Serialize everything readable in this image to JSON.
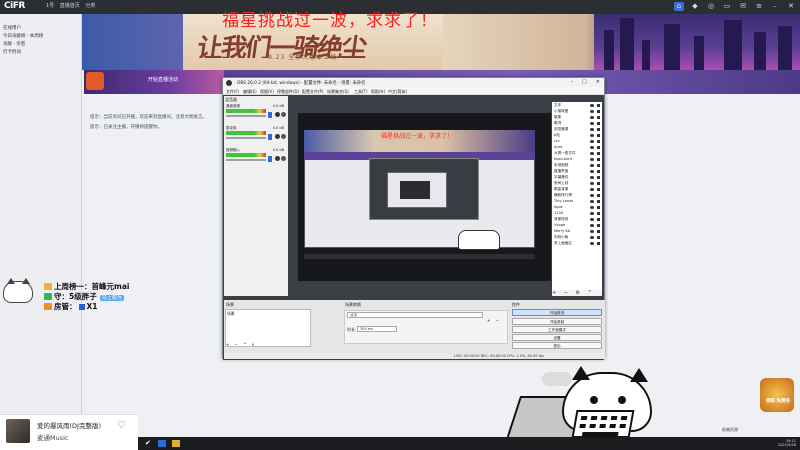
{
  "topbar": {
    "logo": "CiFR",
    "meta": [
      "1号",
      "直播首页",
      "分类"
    ],
    "icons": [
      "home-icon",
      "game-icon",
      "gamepad-icon",
      "tv-icon",
      "chat-icon",
      "menu-icon",
      "minimize-icon",
      "close-icon"
    ]
  },
  "leftpanel": {
    "rows": [
      "在线用户",
      "今日贡献榜 · 本周榜",
      "贡献 · 亲密",
      "打卡时间"
    ]
  },
  "banner": {
    "overlay_text": "福星挑战过一波，求求了！",
    "art_text": "让我们一骑绝尘",
    "subtitle": "9.23 全新大版本上线"
  },
  "promo": {
    "label": "开始直播活动"
  },
  "chat": {
    "lines": [
      "提示：当前房间已开播，欢迎来到直播间，注意文明发言。",
      "提示：已关注主播，开播将提醒你。"
    ]
  },
  "obs": {
    "title": "OBS 26.0.2 (64-bit, windows) - 配置文件: 未命名 - 场景: 未命名",
    "menu": [
      "文件(F)",
      "编辑(E)",
      "视图(V)",
      "停靠部件(D)",
      "配置文件(P)",
      "场景集合(S)",
      "工具(T)",
      "帮助(H)",
      "中文(简体)"
    ],
    "mixer_title": "混音器",
    "tracks": [
      {
        "label": "桌面音频",
        "db": "0.0 dB"
      },
      {
        "label": "麦克风",
        "db": "0.0 dB"
      },
      {
        "label": "音频输入",
        "db": "0.0 dB"
      }
    ],
    "preview_overlay": "福星挑战过一波，求求了！",
    "sources": [
      "文本",
      "小猫咪图",
      "摄像",
      "歌词",
      "浏览器源",
      "b站",
      "ccc",
      "Aunt",
      "大屏一般文件",
      "kkod-bunt",
      "本地视频",
      "直播界面",
      "字幕爆闪",
      "房间上线",
      "歌曲背景",
      "爆款排行榜",
      "Tiny Lands",
      "Ayoe",
      "1204",
      "背景特效",
      "Vcoge",
      "Merry Kb",
      "闪烁小鱼",
      "其上画面区"
    ],
    "source_toolbar": "+ − ⚙ ^ v",
    "scenes_head": "场景",
    "scenes": [
      "场景"
    ],
    "scene_toolbar": "+ − ^ v",
    "transition_head": "场景转换",
    "transition_value": "淡出",
    "duration_label": "时长",
    "duration_value": "300 ms",
    "controls_head": "控件",
    "controls": [
      "开始推流",
      "开始录制",
      "工作室模式",
      "设置",
      "退出"
    ],
    "status": "LIVE: 00:00:00    REC: 00:00:00    CPU: 1.9%, 60.00 fps"
  },
  "viewers": {
    "line1_label": "上周榜一：",
    "line1_name": "首峰元mai",
    "line2_label": "守：",
    "line2_name": "5级胖子",
    "line2_tag": "马上成为",
    "line3_label": "房管：",
    "line3_name": "X1"
  },
  "gift": {
    "label": "领取 免费券"
  },
  "player": {
    "song": "爱的暴风雨(DJ完整版)",
    "artist": "麦通Music"
  },
  "taskbar": {
    "tray_time": "19:11",
    "tray_date": "2021/9/28"
  },
  "browser_status": "前端资源"
}
